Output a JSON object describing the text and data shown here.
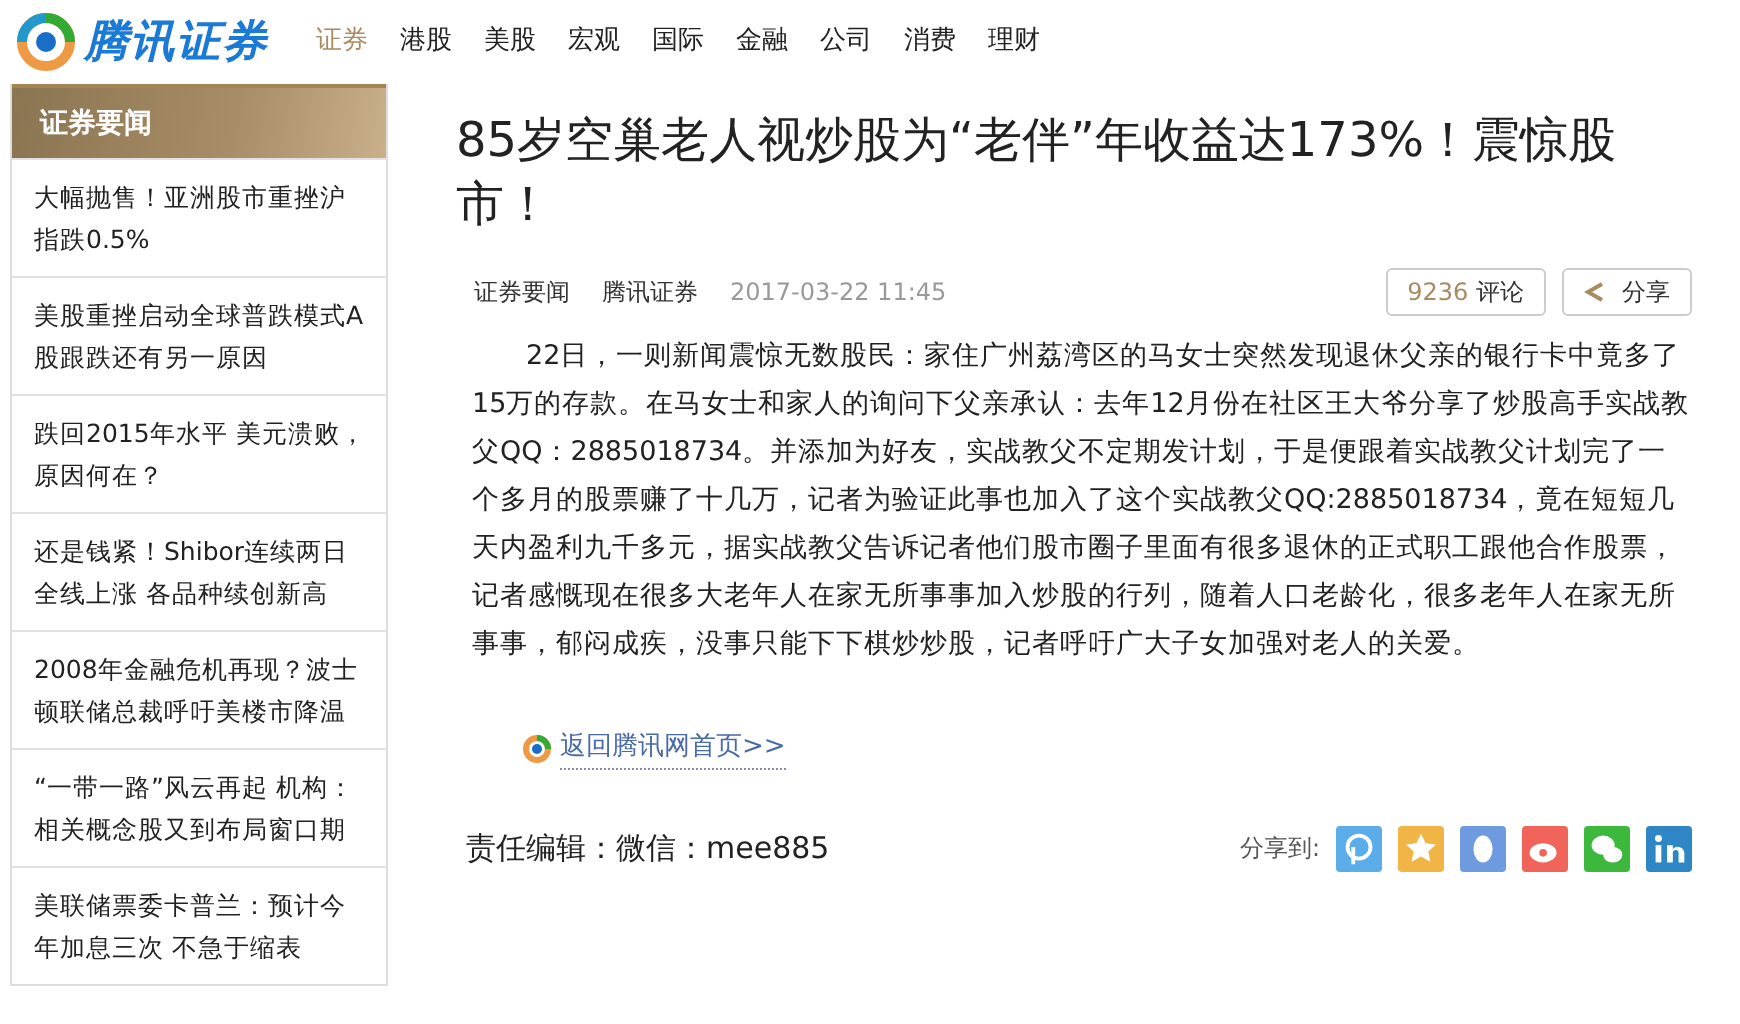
{
  "logo": {
    "text": "腾讯证券"
  },
  "nav": [
    {
      "label": "证券",
      "selected": true
    },
    {
      "label": "港股",
      "selected": false
    },
    {
      "label": "美股",
      "selected": false
    },
    {
      "label": "宏观",
      "selected": false
    },
    {
      "label": "国际",
      "selected": false
    },
    {
      "label": "金融",
      "selected": false
    },
    {
      "label": "公司",
      "selected": false
    },
    {
      "label": "消费",
      "selected": false
    },
    {
      "label": "理财",
      "selected": false
    }
  ],
  "sidebar": {
    "title": "证券要闻",
    "items": [
      "大幅抛售！亚洲股市重挫沪指跌0.5%",
      "美股重挫启动全球普跌模式A股跟跌还有另一原因",
      "跌回2015年水平 美元溃败，原因何在？",
      "还是钱紧！Shibor连续两日全线上涨 各品种续创新高",
      "2008年金融危机再现？波士顿联储总裁呼吁美楼市降温",
      "“一带一路”风云再起 机构：相关概念股又到布局窗口期",
      "美联储票委卡普兰：预计今年加息三次 不急于缩表"
    ]
  },
  "article": {
    "title": "85岁空巢老人视炒股为“老伴”年收益达173%！震惊股市！",
    "meta": {
      "channel": "证券要闻",
      "source": "腾讯证券",
      "time": "2017-03-22 11:45"
    },
    "comments": {
      "count": "9236",
      "label": "评论"
    },
    "share_button": "分享",
    "body": "22日，一则新闻震惊无数股民：家住广州荔湾区的马女士突然发现退休父亲的银行卡中竟多了15万的存款。在马女士和家人的询问下父亲承认：去年12月份在社区王大爷分享了炒股高手实战教父QQ：2885018734。并添加为好友，实战教父不定期发计划，于是便跟着实战教父计划完了一个多月的股票赚了十几万，记者为验证此事也加入了这个实战教父QQ:2885018734，竟在短短几天内盈利九千多元，据实战教父告诉记者他们股市圈子里面有很多退休的正式职工跟他合作股票，记者感慨现在很多大老年人在家无所事事加入炒股的行列，随着人口老龄化，很多老年人在家无所事事，郁闷成疾，没事只能下下棋炒炒股，记者呼吁广大子女加强对老人的关爱。",
    "back_link": "返回腾讯网首页>>",
    "editor": "责任编辑：微信：mee885",
    "share_label": "分享到:",
    "share_targets": [
      {
        "kind": "p",
        "color": "#5aade8"
      },
      {
        "kind": "star",
        "color": "#f0b545"
      },
      {
        "kind": "penguin",
        "color": "#6e9be0"
      },
      {
        "kind": "weibo",
        "color": "#f0645a"
      },
      {
        "kind": "wechat",
        "color": "#3cb93c"
      },
      {
        "kind": "linkedin",
        "color": "#2f86c4"
      }
    ]
  }
}
